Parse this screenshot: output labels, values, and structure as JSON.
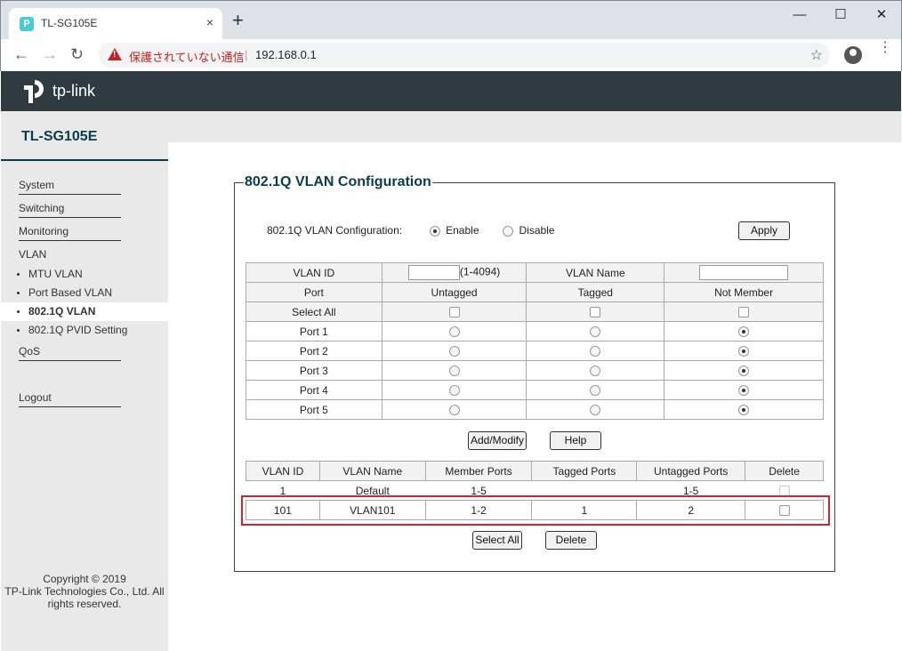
{
  "browser": {
    "tab_title": "TL-SG105E",
    "tab_favicon": "P",
    "tab_close": "×",
    "new_tab": "+",
    "window_controls": {
      "minimize": "—",
      "maximize": "☐",
      "close": "✕"
    },
    "nav": {
      "back": "←",
      "forward": "→",
      "reload": "↻"
    },
    "security_text": "保護されていない通信",
    "url_separator": "|",
    "url": "192.168.0.1",
    "bookmark_star": "☆",
    "menu": "⋮"
  },
  "brand": {
    "logo_text": "tp-link",
    "model": "TL-SG105E"
  },
  "sidebar": {
    "items": [
      {
        "label": "System"
      },
      {
        "label": "Switching"
      },
      {
        "label": "Monitoring"
      },
      {
        "label": "VLAN"
      },
      {
        "label": "QoS"
      },
      {
        "label": "Logout"
      }
    ],
    "vlan_sub": [
      {
        "label": "MTU VLAN",
        "active": false
      },
      {
        "label": "Port Based VLAN",
        "active": false
      },
      {
        "label": "802.1Q VLAN",
        "active": true
      },
      {
        "label": "802.1Q PVID Setting",
        "active": false
      }
    ],
    "copyright": [
      "Copyright © 2019",
      "TP-Link Technologies Co., Ltd. All",
      "rights reserved."
    ]
  },
  "panel": {
    "title": "802.1Q VLAN Configuration",
    "config_label": "802.1Q VLAN Configuration:",
    "enable_label": "Enable",
    "disable_label": "Disable",
    "enabled": true,
    "apply_label": "Apply"
  },
  "vlan_form": {
    "vlan_id_label": "VLAN ID",
    "vlan_id_value": "",
    "vlan_id_range": "(1-4094)",
    "vlan_name_label": "VLAN Name",
    "vlan_name_value": "",
    "col_port": "Port",
    "col_untagged": "Untagged",
    "col_tagged": "Tagged",
    "col_not_member": "Not Member",
    "select_all_label": "Select All",
    "ports": [
      {
        "name": "Port 1",
        "selection": "not_member"
      },
      {
        "name": "Port 2",
        "selection": "not_member"
      },
      {
        "name": "Port 3",
        "selection": "not_member"
      },
      {
        "name": "Port 4",
        "selection": "not_member"
      },
      {
        "name": "Port 5",
        "selection": "not_member"
      }
    ],
    "add_modify_label": "Add/Modify",
    "help_label": "Help"
  },
  "vlan_table": {
    "headers": [
      "VLAN ID",
      "VLAN Name",
      "Member Ports",
      "Tagged Ports",
      "Untagged Ports",
      "Delete"
    ],
    "rows": [
      {
        "id": "1",
        "name": "Default",
        "members": "1-5",
        "tagged": "",
        "untagged": "1-5"
      },
      {
        "id": "101",
        "name": "VLAN101",
        "members": "1-2",
        "tagged": "1",
        "untagged": "2"
      }
    ],
    "select_all_label": "Select All",
    "delete_label": "Delete"
  },
  "colors": {
    "header_bg": "#2f3b41",
    "brand_teal": "#0a3d4c",
    "sidebar_bg": "#e9e9e9",
    "highlight_red": "#d9222a"
  }
}
